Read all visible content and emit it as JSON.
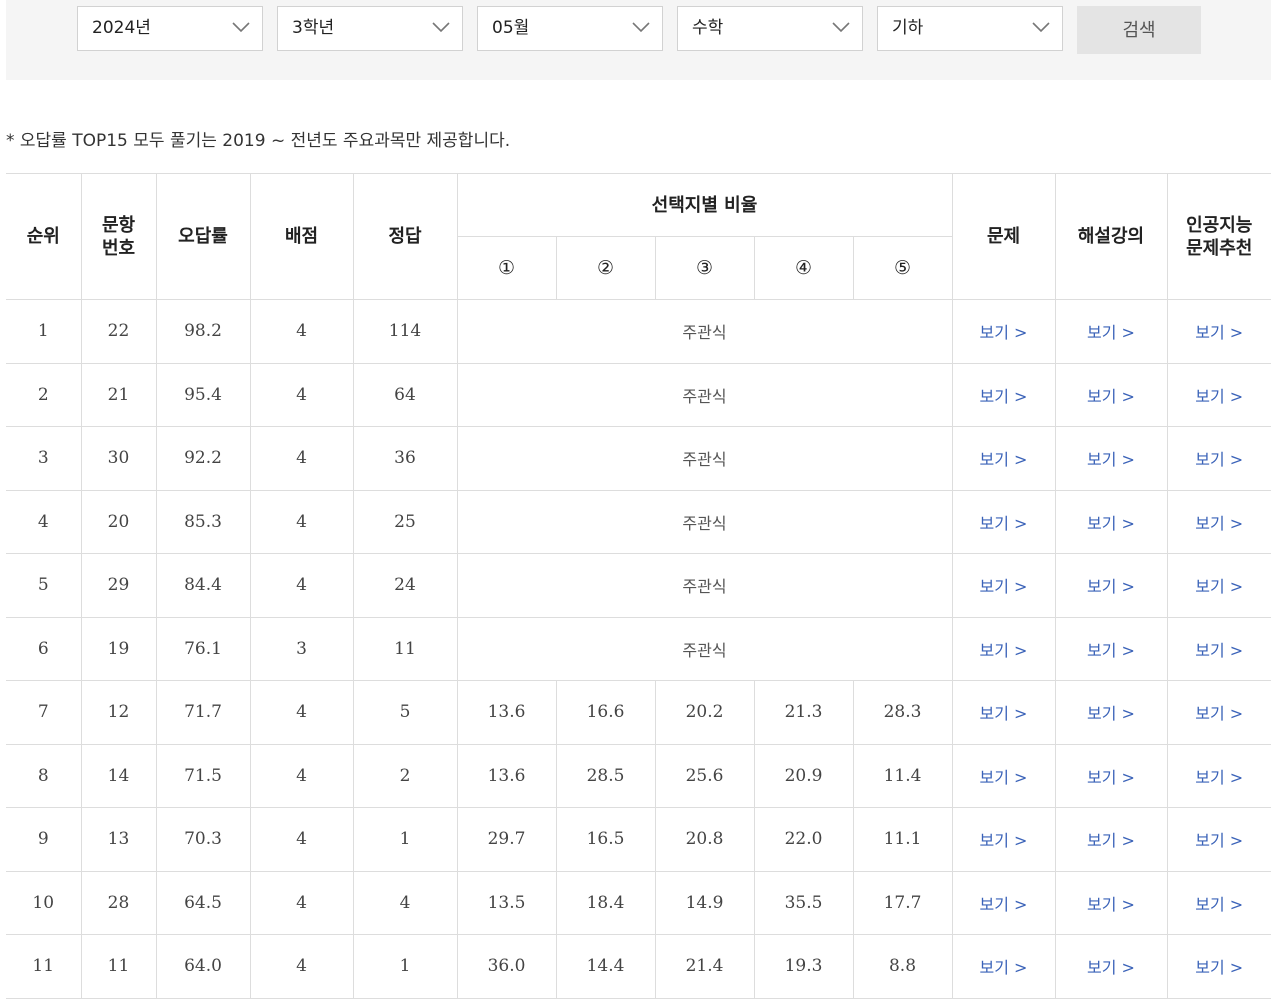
{
  "filters": {
    "year": "2024년",
    "grade": "3학년",
    "month": "05월",
    "subject": "수학",
    "sub_subject": "기하",
    "search_label": "검색"
  },
  "notice": "* 오답률 TOP15 모두 풀기는 2019 ~ 전년도 주요과목만 제공합니다.",
  "table": {
    "headers": {
      "rank": "순위",
      "qnum": "문항\n번호",
      "error_rate": "오답률",
      "points": "배점",
      "answer": "정답",
      "choice_ratio": "선택지별 비율",
      "choices": [
        "①",
        "②",
        "③",
        "④",
        "⑤"
      ],
      "problem": "문제",
      "lecture": "해설강의",
      "ai": "인공지능\n문제추천"
    },
    "subjective_label": "주관식",
    "view_label": "보기 >",
    "rows": [
      {
        "rank": "1",
        "qnum": "22",
        "error_rate": "98.2",
        "points": "4",
        "answer": "114",
        "ratios": null
      },
      {
        "rank": "2",
        "qnum": "21",
        "error_rate": "95.4",
        "points": "4",
        "answer": "64",
        "ratios": null
      },
      {
        "rank": "3",
        "qnum": "30",
        "error_rate": "92.2",
        "points": "4",
        "answer": "36",
        "ratios": null
      },
      {
        "rank": "4",
        "qnum": "20",
        "error_rate": "85.3",
        "points": "4",
        "answer": "25",
        "ratios": null
      },
      {
        "rank": "5",
        "qnum": "29",
        "error_rate": "84.4",
        "points": "4",
        "answer": "24",
        "ratios": null
      },
      {
        "rank": "6",
        "qnum": "19",
        "error_rate": "76.1",
        "points": "3",
        "answer": "11",
        "ratios": null
      },
      {
        "rank": "7",
        "qnum": "12",
        "error_rate": "71.7",
        "points": "4",
        "answer": "5",
        "ratios": [
          "13.6",
          "16.6",
          "20.2",
          "21.3",
          "28.3"
        ]
      },
      {
        "rank": "8",
        "qnum": "14",
        "error_rate": "71.5",
        "points": "4",
        "answer": "2",
        "ratios": [
          "13.6",
          "28.5",
          "25.6",
          "20.9",
          "11.4"
        ]
      },
      {
        "rank": "9",
        "qnum": "13",
        "error_rate": "70.3",
        "points": "4",
        "answer": "1",
        "ratios": [
          "29.7",
          "16.5",
          "20.8",
          "22.0",
          "11.1"
        ]
      },
      {
        "rank": "10",
        "qnum": "28",
        "error_rate": "64.5",
        "points": "4",
        "answer": "4",
        "ratios": [
          "13.5",
          "18.4",
          "14.9",
          "35.5",
          "17.7"
        ]
      },
      {
        "rank": "11",
        "qnum": "11",
        "error_rate": "64.0",
        "points": "4",
        "answer": "1",
        "ratios": [
          "36.0",
          "14.4",
          "21.4",
          "19.3",
          "8.8"
        ]
      }
    ]
  }
}
